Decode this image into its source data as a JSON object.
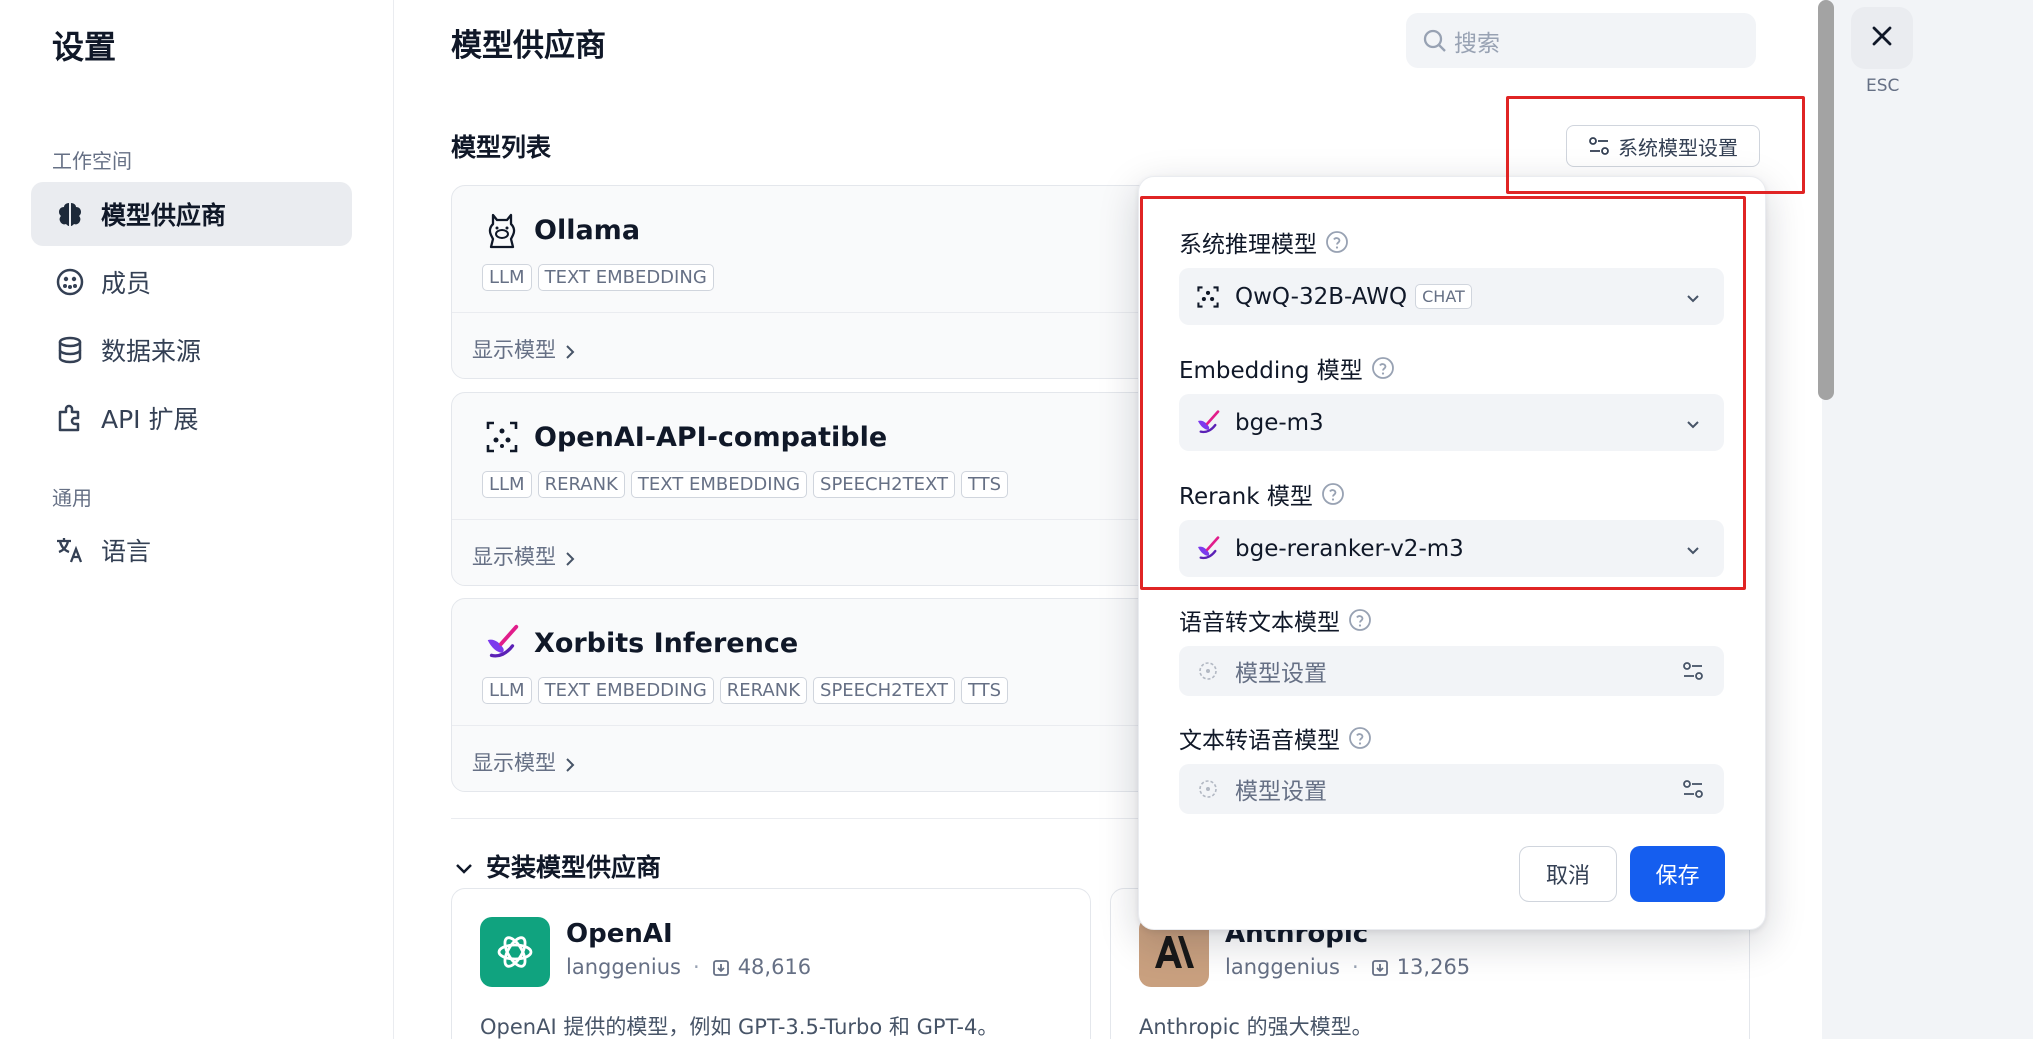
{
  "sidebar": {
    "title": "设置",
    "section_workspace": "工作空间",
    "section_general": "通用",
    "items": [
      {
        "label": "模型供应商",
        "icon": "brain-icon"
      },
      {
        "label": "成员",
        "icon": "users-icon"
      },
      {
        "label": "数据来源",
        "icon": "database-icon"
      },
      {
        "label": "API 扩展",
        "icon": "puzzle-icon"
      },
      {
        "label": "语言",
        "icon": "translate-icon"
      }
    ]
  },
  "header": {
    "title": "模型供应商",
    "search_placeholder": "搜索"
  },
  "model_list": {
    "title": "模型列表",
    "system_settings_button": "系统模型设置",
    "show_models": "显示模型",
    "providers": [
      {
        "name": "Ollama",
        "tags": [
          "LLM",
          "TEXT EMBEDDING"
        ]
      },
      {
        "name": "OpenAI-API-compatible",
        "tags": [
          "LLM",
          "RERANK",
          "TEXT EMBEDDING",
          "SPEECH2TEXT",
          "TTS"
        ]
      },
      {
        "name": "Xorbits Inference",
        "tags": [
          "LLM",
          "TEXT EMBEDDING",
          "RERANK",
          "SPEECH2TEXT",
          "TTS"
        ]
      }
    ]
  },
  "install": {
    "title": "安装模型供应商",
    "cards": [
      {
        "name": "OpenAI",
        "author": "langgenius",
        "downloads": "48,616",
        "desc": "OpenAI 提供的模型，例如 GPT-3.5-Turbo 和 GPT-4。"
      },
      {
        "name": "Anthropic",
        "author": "langgenius",
        "downloads": "13,265",
        "desc": "Anthropic 的强大模型。"
      }
    ]
  },
  "popover": {
    "reasoning": {
      "label": "系统推理模型",
      "value": "QwQ-32B-AWQ",
      "badge": "CHAT"
    },
    "embedding": {
      "label": "Embedding 模型",
      "value": "bge-m3"
    },
    "rerank": {
      "label": "Rerank 模型",
      "value": "bge-reranker-v2-m3"
    },
    "stt": {
      "label": "语音转文本模型",
      "placeholder": "模型设置"
    },
    "tts": {
      "label": "文本转语音模型",
      "placeholder": "模型设置"
    },
    "cancel": "取消",
    "save": "保存"
  },
  "close": {
    "label": "ESC"
  },
  "colors": {
    "accent": "#155eef",
    "highlight": "#e02424"
  }
}
